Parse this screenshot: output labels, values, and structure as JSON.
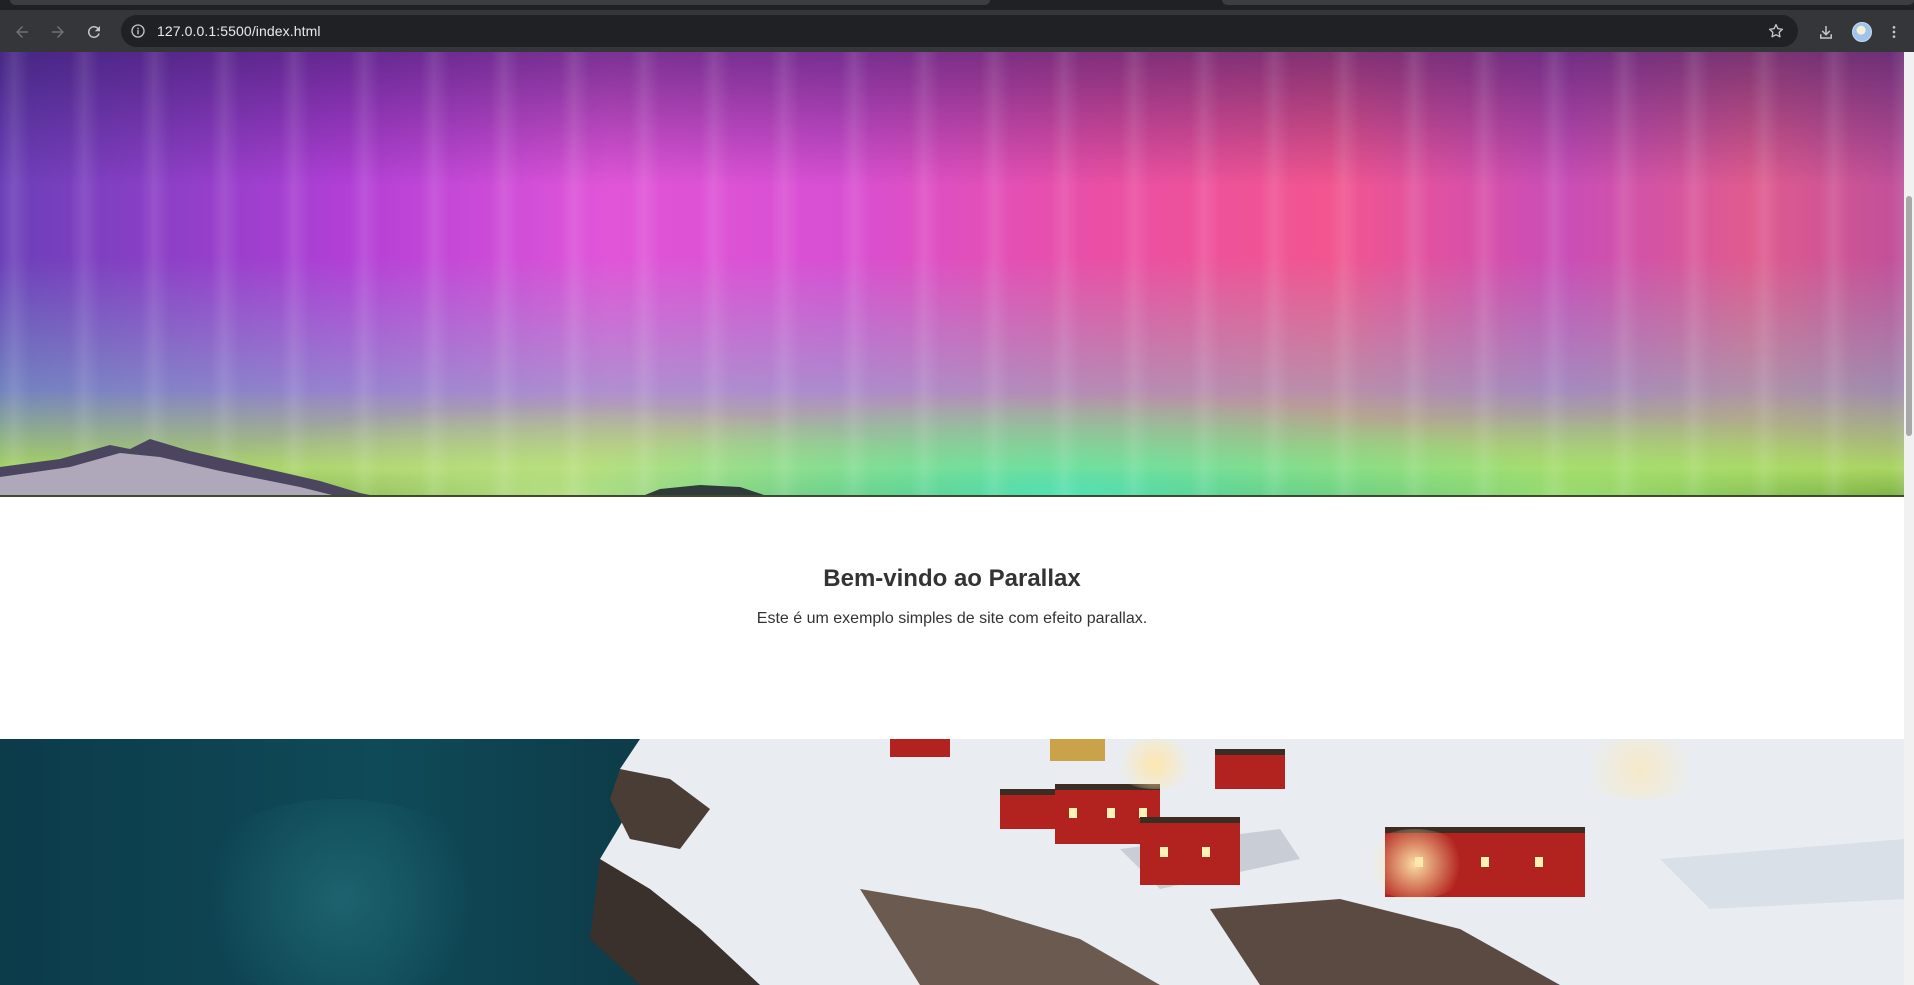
{
  "browser": {
    "url": "127.0.0.1:5500/index.html",
    "icons": [
      "back-icon",
      "forward-icon",
      "reload-icon",
      "site-info-icon",
      "bookmark-star-icon",
      "download-icon",
      "profile-avatar",
      "menu-kebab-icon"
    ]
  },
  "page": {
    "intro": {
      "heading": "Bem-vindo ao Parallax",
      "text": "Este é um exemplo simples de site com efeito parallax."
    }
  },
  "colors": {
    "chrome_bg": "#35363a",
    "omnibox_bg": "#202124",
    "text_dark": "#333333"
  }
}
